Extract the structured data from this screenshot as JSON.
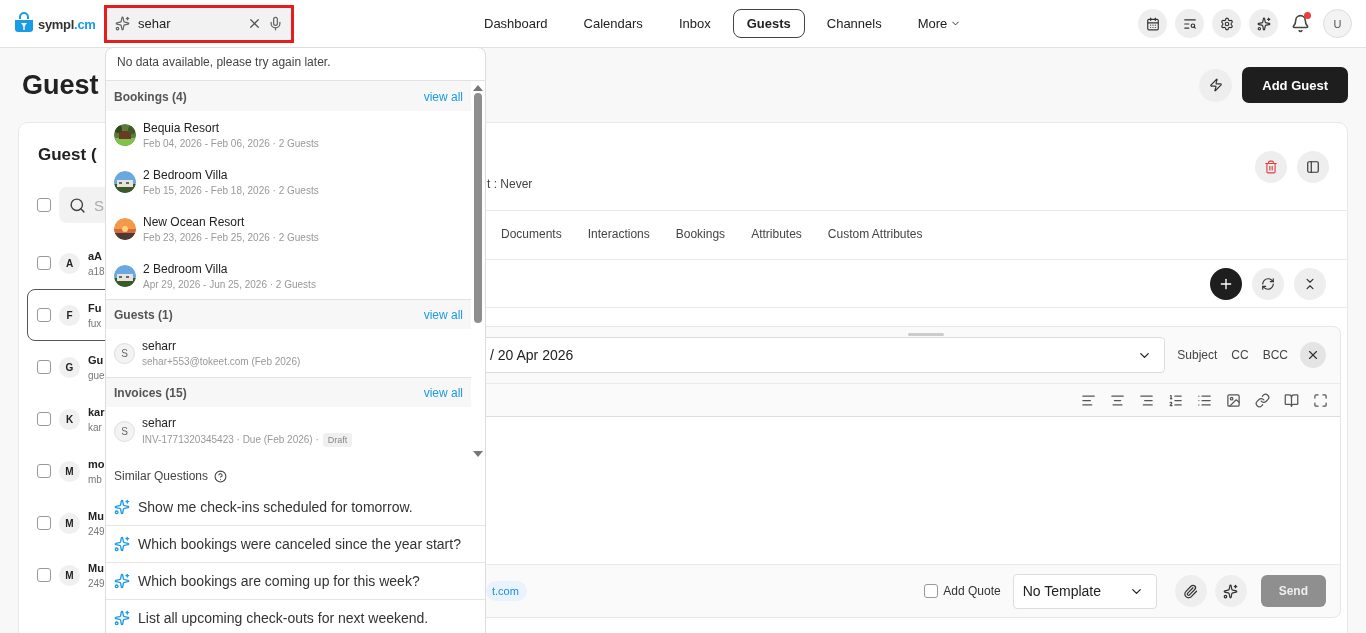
{
  "header": {
    "logo": {
      "name": "sympl",
      "suffix": ".cm"
    },
    "search": {
      "value": "sehar"
    },
    "nav": [
      {
        "label": "Dashboard",
        "selected": false,
        "kind": "link"
      },
      {
        "label": "Calendars",
        "selected": false,
        "kind": "link"
      },
      {
        "label": "Inbox",
        "selected": false,
        "kind": "link"
      },
      {
        "label": "Guests",
        "selected": true,
        "kind": "link"
      },
      {
        "label": "Channels",
        "selected": false,
        "kind": "link"
      },
      {
        "label": "More",
        "selected": false,
        "kind": "menu"
      }
    ],
    "notifications": {
      "unread": true
    },
    "avatar": "U"
  },
  "page": {
    "title": "Guest",
    "primary_action": "Add Guest"
  },
  "guest_list": {
    "title": "Guest (",
    "search_placeholder": "S",
    "all_checked": false,
    "rows": [
      {
        "initial": "A",
        "name": "aA",
        "detail": "a18",
        "selected": false,
        "checked": false
      },
      {
        "initial": "F",
        "name": "Fu",
        "detail": "fux",
        "selected": true,
        "checked": false
      },
      {
        "initial": "G",
        "name": "Gu",
        "detail": "gue",
        "selected": false,
        "checked": false
      },
      {
        "initial": "K",
        "name": "kar",
        "detail": "kar",
        "selected": false,
        "checked": false
      },
      {
        "initial": "M",
        "name": "mo",
        "detail": "mb",
        "selected": false,
        "checked": false
      },
      {
        "initial": "M",
        "name": "Mu",
        "detail": "249",
        "selected": false,
        "checked": false
      },
      {
        "initial": "M",
        "name": "Mu",
        "detail": "249",
        "selected": false,
        "checked": false
      }
    ]
  },
  "detail": {
    "meta": "t : Never",
    "tabs": [
      {
        "label": "Documents",
        "selected": false
      },
      {
        "label": "Interactions",
        "selected": false
      },
      {
        "label": "Bookings",
        "selected": false
      },
      {
        "label": "Attributes",
        "selected": false
      },
      {
        "label": "Custom Attributes",
        "selected": false
      }
    ],
    "composer": {
      "subject": "/ 20 Apr 2026",
      "fields": [
        "Subject",
        "CC",
        "BCC"
      ],
      "recipient": "t.com",
      "add_quote": {
        "label": "Add Quote",
        "checked": false
      },
      "template": "No Template",
      "send": {
        "label": "Send",
        "disabled": true
      }
    }
  },
  "search_dropdown": {
    "message": "No data available, please try again later.",
    "sections": [
      {
        "kind": "bookings",
        "title": "Bookings (4)",
        "action": "view all",
        "items": [
          {
            "title": "Bequia Resort",
            "subtitle": "Feb 04, 2026 - Feb 06, 2026 · 2 Guests"
          },
          {
            "title": "2 Bedroom Villa",
            "subtitle": "Feb 15, 2026 - Feb 18, 2026 · 2 Guests"
          },
          {
            "title": "New Ocean Resort",
            "subtitle": "Feb 23, 2026 - Feb 25, 2026 · 2 Guests"
          },
          {
            "title": "2 Bedroom Villa",
            "subtitle": "Apr 29, 2026 - Jun 25, 2026 · 2 Guests"
          }
        ]
      },
      {
        "kind": "guests",
        "title": "Guests (1)",
        "action": "view all",
        "items": [
          {
            "initial": "S",
            "title": "seharr",
            "subtitle": "sehar+553@tokeet.com (Feb 2026)"
          }
        ]
      },
      {
        "kind": "invoices",
        "title": "Invoices (15)",
        "action": "view all",
        "items": [
          {
            "initial": "S",
            "title": "seharr",
            "subtitle": "INV-1771320345423 · Due (Feb 2026) ·",
            "badge": "Draft"
          }
        ]
      }
    ],
    "similar": {
      "title": "Similar Questions",
      "questions": [
        "Show me check-ins scheduled for tomorrow.",
        "Which bookings were canceled since the year start?",
        "Which bookings are coming up for this week?",
        "List all upcoming check-outs for next weekend."
      ]
    }
  }
}
